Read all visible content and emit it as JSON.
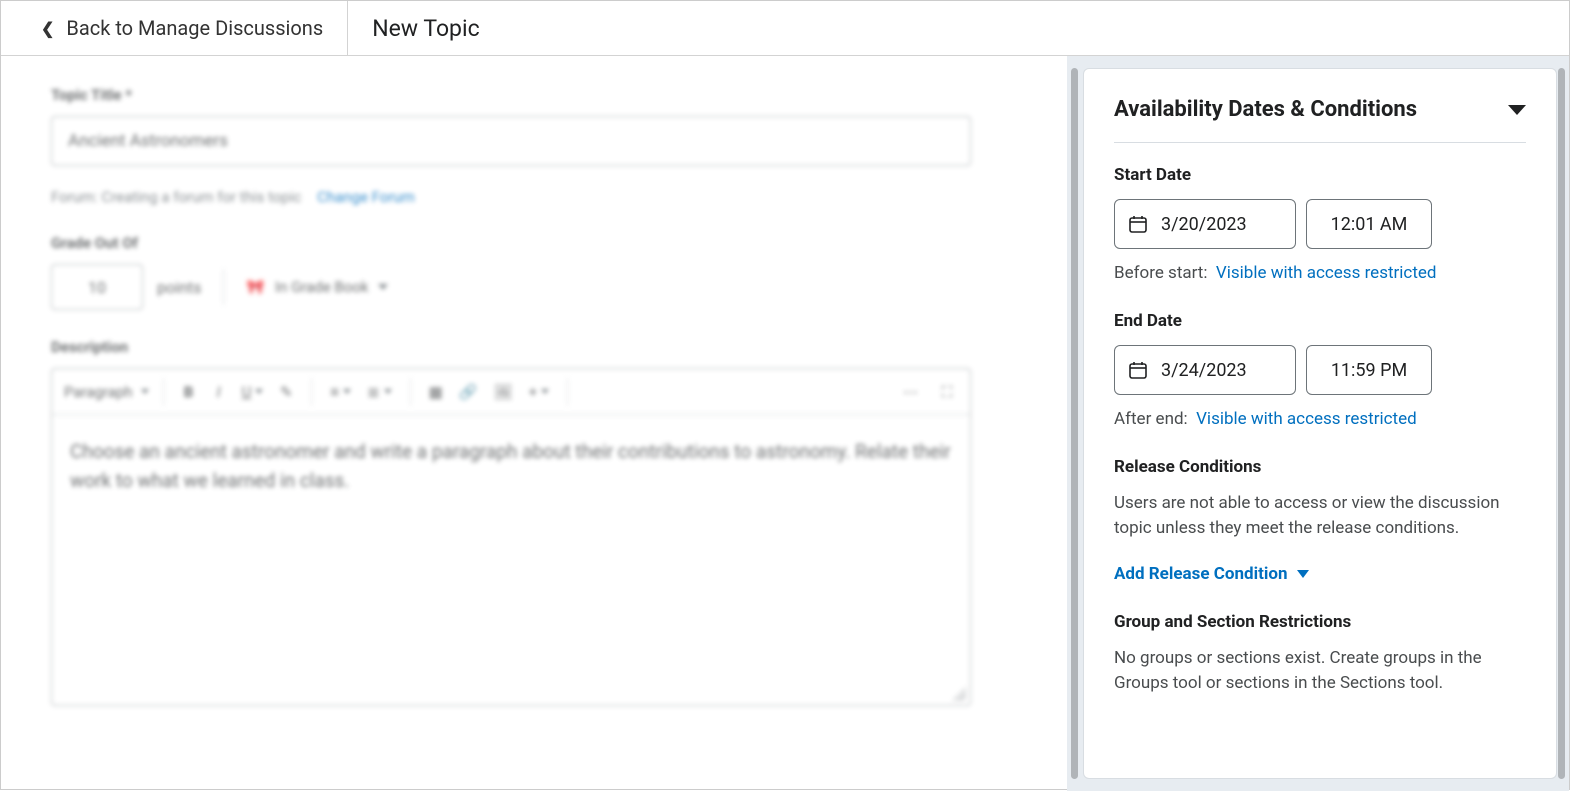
{
  "header": {
    "back_label": "Back to Manage Discussions",
    "title": "New Topic"
  },
  "form": {
    "topic_title_label": "Topic Title *",
    "topic_title_value": "Ancient Astronomers",
    "forum_line": "Forum: Creating a forum for this topic",
    "change_forum": "Change Forum",
    "grade_label": "Grade Out Of",
    "points_value": "10",
    "points_suffix": "points",
    "in_gradebook": "In Grade Book",
    "description_label": "Description",
    "editor_paragraph": "Paragraph",
    "editor_body": "Choose an ancient astronomer and write a paragraph about their contributions to astronomy. Relate their work to what we learned in class."
  },
  "availability": {
    "panel_title": "Availability Dates & Conditions",
    "start_label": "Start Date",
    "start_date": "3/20/2023",
    "start_time": "12:01 AM",
    "before_start_label": "Before start:",
    "before_start_link": "Visible with access restricted",
    "end_label": "End Date",
    "end_date": "3/24/2023",
    "end_time": "11:59 PM",
    "after_end_label": "After end:",
    "after_end_link": "Visible with access restricted",
    "release_heading": "Release Conditions",
    "release_desc": "Users are not able to access or view the discussion topic unless they meet the release conditions.",
    "add_release_label": "Add Release Condition",
    "group_heading": "Group and Section Restrictions",
    "group_desc": "No groups or sections exist. Create groups in the Groups tool or sections in the Sections tool."
  }
}
